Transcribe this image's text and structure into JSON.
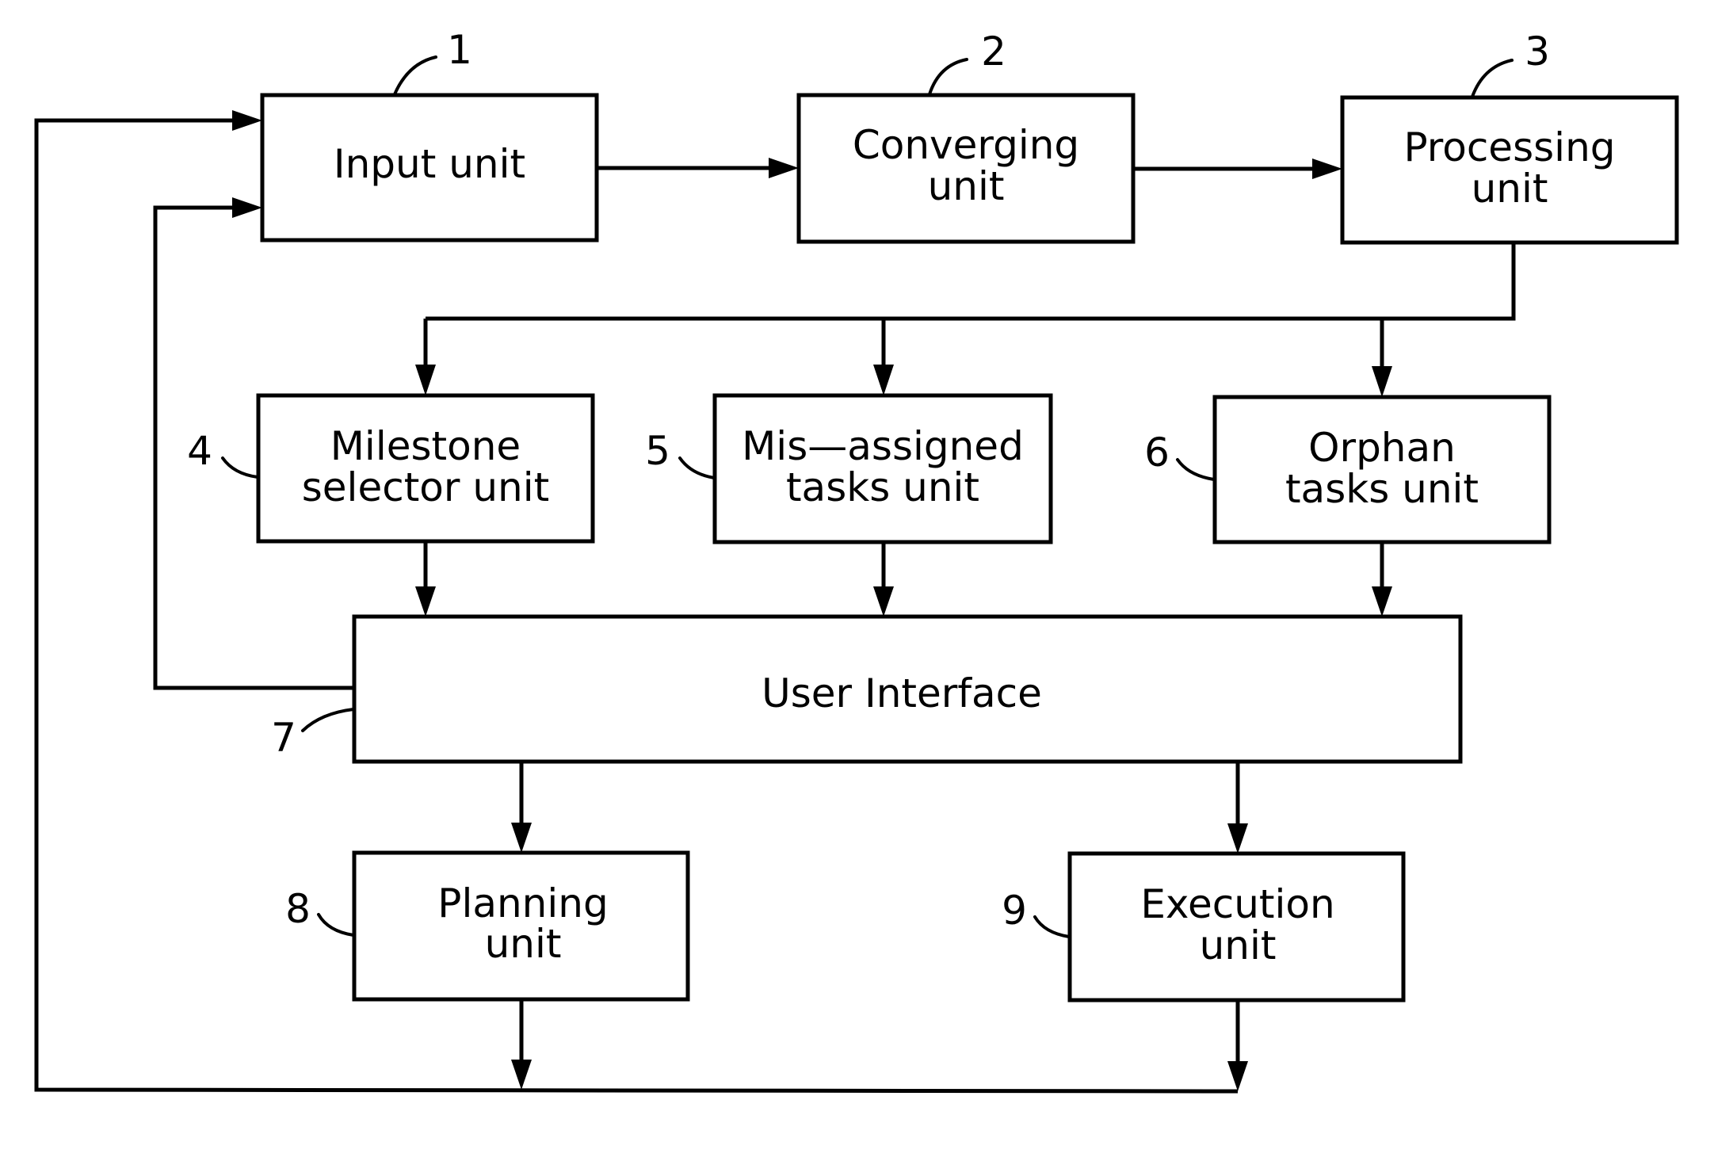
{
  "diagram": {
    "type": "block-diagram",
    "units": [
      {
        "id": "input",
        "ref": "1",
        "lines": [
          "Input  unit"
        ]
      },
      {
        "id": "converging",
        "ref": "2",
        "lines": [
          "Converging",
          "unit"
        ]
      },
      {
        "id": "processing",
        "ref": "3",
        "lines": [
          "Processing",
          "unit"
        ]
      },
      {
        "id": "milestone",
        "ref": "4",
        "lines": [
          "Milestone",
          "selector  unit"
        ]
      },
      {
        "id": "misassigned",
        "ref": "5",
        "lines": [
          "Mis—assigned",
          "tasks  unit"
        ]
      },
      {
        "id": "orphan",
        "ref": "6",
        "lines": [
          "Orphan",
          "tasks  unit"
        ]
      },
      {
        "id": "ui",
        "ref": "7",
        "lines": [
          "User  Interface"
        ]
      },
      {
        "id": "planning",
        "ref": "8",
        "lines": [
          "Planning",
          "unit"
        ]
      },
      {
        "id": "execution",
        "ref": "9",
        "lines": [
          "Execution",
          "unit"
        ]
      }
    ],
    "connections": [
      {
        "from": "input",
        "to": "converging"
      },
      {
        "from": "converging",
        "to": "processing"
      },
      {
        "from": "processing",
        "to": "milestone"
      },
      {
        "from": "processing",
        "to": "misassigned"
      },
      {
        "from": "processing",
        "to": "orphan"
      },
      {
        "from": "milestone",
        "to": "ui"
      },
      {
        "from": "misassigned",
        "to": "ui"
      },
      {
        "from": "orphan",
        "to": "ui"
      },
      {
        "from": "ui",
        "to": "input"
      },
      {
        "from": "ui",
        "to": "planning"
      },
      {
        "from": "ui",
        "to": "execution"
      },
      {
        "from": "planning",
        "to": "input"
      },
      {
        "from": "execution",
        "to": "input"
      }
    ]
  }
}
